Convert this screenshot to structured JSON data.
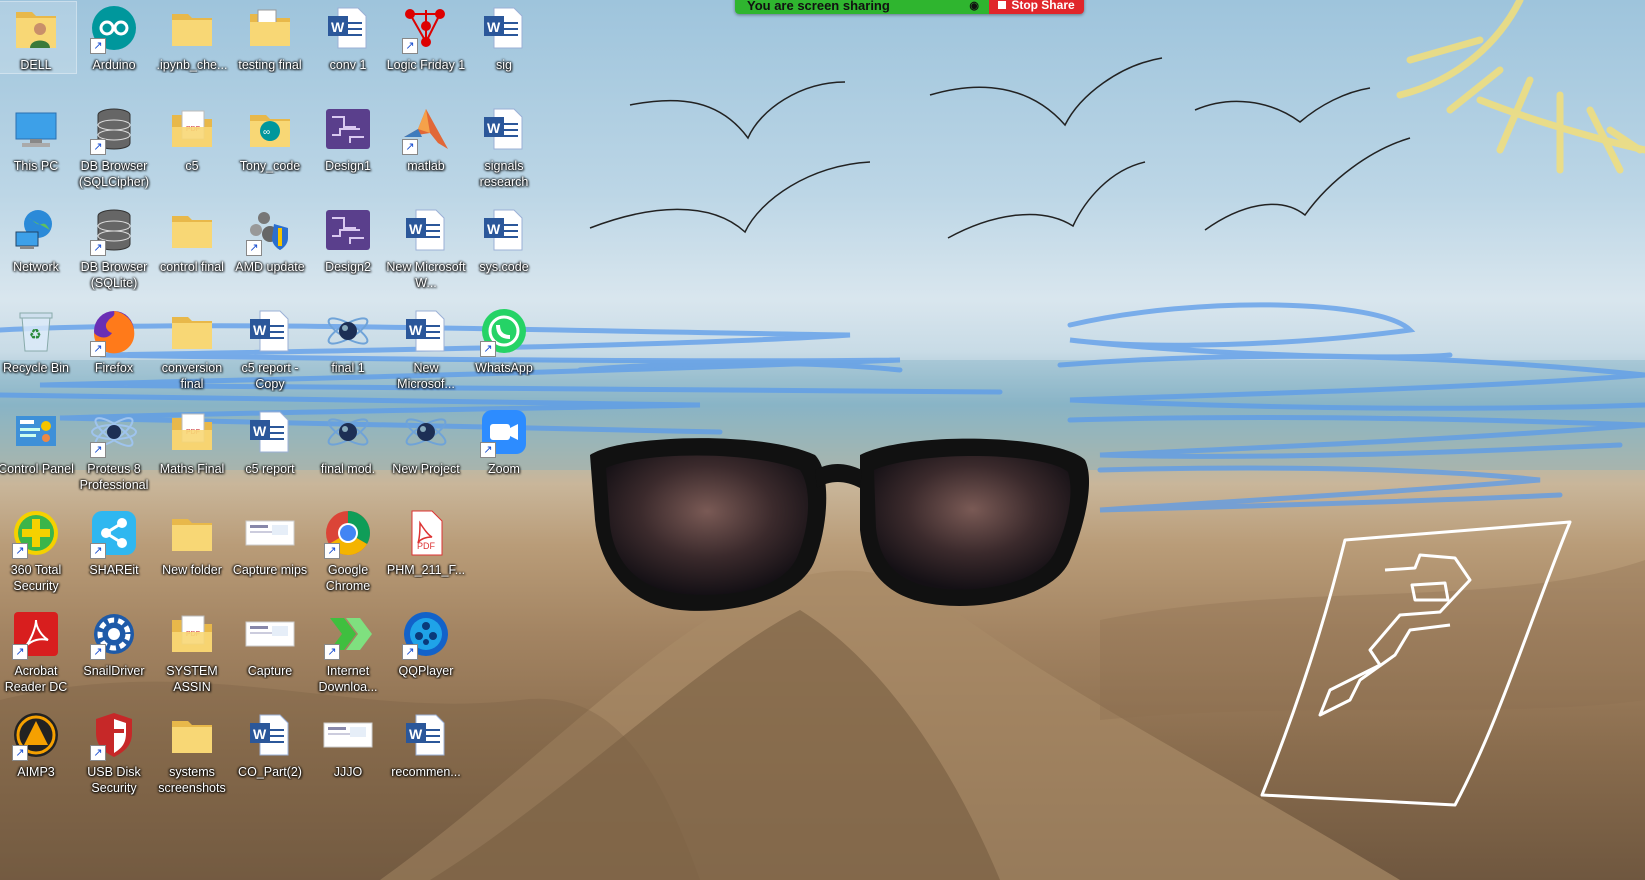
{
  "screen_share": {
    "status_text": "You are screen sharing",
    "stop_label": "Stop Share",
    "status_color": "#2fb52f",
    "stop_color": "#e0262b"
  },
  "desktop": {
    "icons": [
      {
        "label": "DELL",
        "icon": "user-folder-icon",
        "shortcut": false,
        "selected": true
      },
      {
        "label": "Arduino",
        "icon": "arduino-icon",
        "shortcut": true
      },
      {
        "label": ".ipynb_che...",
        "icon": "folder-icon",
        "shortcut": false
      },
      {
        "label": "testing final",
        "icon": "folder-docs-icon",
        "shortcut": false
      },
      {
        "label": "conv 1",
        "icon": "word-document-icon",
        "shortcut": false
      },
      {
        "label": "Logic Friday 1",
        "icon": "logic-friday-icon",
        "shortcut": true
      },
      {
        "label": "sig",
        "icon": "word-document-icon",
        "shortcut": false
      },
      {
        "label": "This PC",
        "icon": "computer-icon",
        "shortcut": false
      },
      {
        "label": "DB Browser (SQLCipher)",
        "icon": "database-icon",
        "shortcut": true
      },
      {
        "label": "c5",
        "icon": "folder-pdf-icon",
        "shortcut": false
      },
      {
        "label": "Tony_code",
        "icon": "arduino-folder-icon",
        "shortcut": false
      },
      {
        "label": "Design1",
        "icon": "circuit-design-icon",
        "shortcut": false
      },
      {
        "label": "matlab",
        "icon": "matlab-icon",
        "shortcut": true
      },
      {
        "label": "signals research",
        "icon": "word-document-icon",
        "shortcut": false
      },
      {
        "label": "Network",
        "icon": "network-globe-icon",
        "shortcut": false
      },
      {
        "label": "DB Browser (SQLite)",
        "icon": "database-icon",
        "shortcut": true
      },
      {
        "label": "control final",
        "icon": "folder-icon",
        "shortcut": false
      },
      {
        "label": "AMD update",
        "icon": "amd-update-icon",
        "shortcut": true
      },
      {
        "label": "Design2",
        "icon": "circuit-design-icon",
        "shortcut": false
      },
      {
        "label": "New Microsoft W...",
        "icon": "word-document-icon",
        "shortcut": false
      },
      {
        "label": "sys.code",
        "icon": "word-document-icon",
        "shortcut": false
      },
      {
        "label": "Recycle Bin",
        "icon": "recycle-bin-icon",
        "shortcut": false
      },
      {
        "label": "Firefox",
        "icon": "firefox-icon",
        "shortcut": true
      },
      {
        "label": "conversion final",
        "icon": "folder-icon",
        "shortcut": false
      },
      {
        "label": "c5 report - Copy",
        "icon": "word-document-icon",
        "shortcut": false
      },
      {
        "label": "final 1",
        "icon": "proteus-file-icon",
        "shortcut": false
      },
      {
        "label": "New Microsof...",
        "icon": "word-document-icon",
        "shortcut": false
      },
      {
        "label": "WhatsApp",
        "icon": "whatsapp-icon",
        "shortcut": true
      },
      {
        "label": "Control Panel",
        "icon": "control-panel-icon",
        "shortcut": false
      },
      {
        "label": "Proteus 8 Professional",
        "icon": "proteus-icon",
        "shortcut": true
      },
      {
        "label": "Maths Final",
        "icon": "folder-pdf-icon",
        "shortcut": false
      },
      {
        "label": "c5 report",
        "icon": "word-document-icon",
        "shortcut": false
      },
      {
        "label": "final mod.",
        "icon": "proteus-file-icon",
        "shortcut": false
      },
      {
        "label": "New Project",
        "icon": "proteus-file-icon",
        "shortcut": false
      },
      {
        "label": "Zoom",
        "icon": "zoom-icon",
        "shortcut": true
      },
      {
        "label": "360 Total Security",
        "icon": "360-security-icon",
        "shortcut": true
      },
      {
        "label": "SHAREit",
        "icon": "shareit-icon",
        "shortcut": true
      },
      {
        "label": "New folder",
        "icon": "folder-icon",
        "shortcut": false
      },
      {
        "label": "Capture mips",
        "icon": "image-thumbnail-icon",
        "shortcut": false
      },
      {
        "label": "Google Chrome",
        "icon": "chrome-icon",
        "shortcut": true
      },
      {
        "label": "PHM_211_F...",
        "icon": "pdf-icon",
        "shortcut": false
      },
      {
        "label": "Acrobat Reader DC",
        "icon": "acrobat-icon",
        "shortcut": true
      },
      {
        "label": "SnailDriver",
        "icon": "gear-icon",
        "shortcut": true
      },
      {
        "label": "SYSTEM ASSIN",
        "icon": "folder-pdf-icon",
        "shortcut": false
      },
      {
        "label": "Capture",
        "icon": "image-thumbnail-icon",
        "shortcut": false
      },
      {
        "label": "Internet Downloa...",
        "icon": "idm-icon",
        "shortcut": true
      },
      {
        "label": "QQPlayer",
        "icon": "qqplayer-icon",
        "shortcut": true
      },
      {
        "label": "AIMP3",
        "icon": "aimp-icon",
        "shortcut": true
      },
      {
        "label": "USB Disk Security",
        "icon": "shield-icon",
        "shortcut": true
      },
      {
        "label": "systems screenshots",
        "icon": "folder-icon",
        "shortcut": false
      },
      {
        "label": "CO_Part(2)",
        "icon": "word-document-icon",
        "shortcut": false
      },
      {
        "label": "JJJO",
        "icon": "image-thumbnail-icon",
        "shortcut": false
      },
      {
        "label": "recommen...",
        "icon": "word-document-icon",
        "shortcut": false
      }
    ]
  }
}
